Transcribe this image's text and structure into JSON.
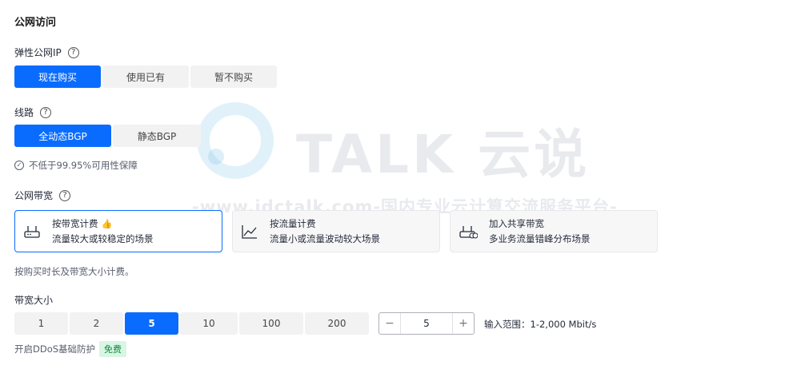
{
  "section": {
    "title": "公网访问"
  },
  "eip": {
    "label": "弹性公网IP",
    "options": [
      "现在购买",
      "使用已有",
      "暂不购买"
    ],
    "selected": 0
  },
  "line": {
    "label": "线路",
    "options": [
      "全动态BGP",
      "静态BGP"
    ],
    "selected": 0,
    "guarantee": "不低于99.95%可用性保障"
  },
  "bandwidth_billing": {
    "label": "公网带宽",
    "cards": [
      {
        "title": "按带宽计费",
        "desc": "流量较大或较稳定的场景",
        "icon": "router-icon",
        "recommended": true
      },
      {
        "title": "按流量计费",
        "desc": "流量小或流量波动较大场景",
        "icon": "line-chart-icon"
      },
      {
        "title": "加入共享带宽",
        "desc": "多业务流量错峰分布场景",
        "icon": "shared-router-icon"
      }
    ],
    "selected": 0,
    "note": "按购买时长及带宽大小计费。"
  },
  "bandwidth_size": {
    "label": "带宽大小",
    "options": [
      "1",
      "2",
      "5",
      "10",
      "100",
      "200"
    ],
    "selected": 2,
    "stepper": {
      "minus": "−",
      "value": "5",
      "plus": "+"
    },
    "range": "输入范围：1-2,000 Mbit/s"
  },
  "ddos": {
    "label": "开启DDoS基础防护",
    "badge": "免费"
  },
  "watermark": {
    "logo": "TALK 云说",
    "url": "-www.idctalk.com-国内专业云计算交流服务平台-"
  },
  "colors": {
    "accent": "#0a6cff",
    "free_badge_bg": "#d9f5e3",
    "free_badge_text": "#0e8a3f"
  }
}
